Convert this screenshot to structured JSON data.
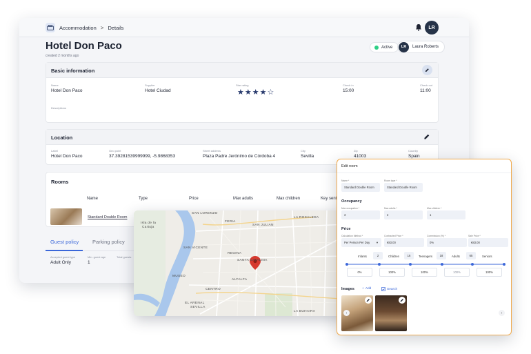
{
  "header": {
    "breadcrumb_root": "Accommodation",
    "breadcrumb_sep": ">",
    "breadcrumb_current": "Details",
    "user_initials": "LR"
  },
  "hotel": {
    "title": "Hotel Don Paco",
    "created": "created 2 months ago",
    "status": "Active",
    "user_initials": "LR",
    "user_name": "Laura Roberts"
  },
  "basic_info": {
    "title": "Basic information",
    "name_label": "Name",
    "name_value": "Hotel Don Paco",
    "supplier_label": "Supplier",
    "supplier_value": "Hotel Ciudad",
    "star_label": "Star rating",
    "star_rating": 4,
    "star_max": 5,
    "stars_text": "★★★★☆",
    "checkin_label": "Check in",
    "checkin_value": "15:00",
    "checkout_label": "Check out",
    "checkout_value": "11:00",
    "descriptions_label": "Descriptions"
  },
  "location": {
    "title": "Location",
    "label_label": "Label",
    "label_value": "Hotel Don Paco",
    "geo_label": "Geo point",
    "geo_value": "37.39281539999999, -5.9868353",
    "street_label": "Street address",
    "street_value": "Plaza Padre Jerónimo de Córdoba 4",
    "city_label": "City",
    "city_value": "Sevilla",
    "zip_label": "Zip",
    "zip_value": "41003",
    "country_label": "Country",
    "country_value": "Spain"
  },
  "rooms": {
    "title": "Rooms",
    "columns": [
      "Name",
      "Type",
      "Price",
      "Max adults",
      "Max children",
      "Key sentence"
    ],
    "row_name": "Standard Double Room"
  },
  "tabs": {
    "guest_policy": "Guest policy",
    "parking_policy": "Parking policy",
    "accepted_label": "Accepted guest type",
    "min_age_label": "Min. guest age",
    "total_label": "Total guests",
    "accepted_value": "Adult Only",
    "min_age_value": "1"
  },
  "map": {
    "labels": [
      "SAN LORENZO",
      "Isla de la",
      "Cartuja",
      "FERIA",
      "SAN JULIAN",
      "LA ROSALEDA",
      "SAN VICENTE",
      "REGINA",
      "SANTA CATALINA",
      "MUSEO",
      "ALFALFA",
      "CENTRO",
      "EL ARENAL",
      "SEVILLA",
      "LA BUHAIRA"
    ]
  },
  "edit_room": {
    "title": "Edit room",
    "name_label": "Name *",
    "name_value": "Standard Double Room",
    "room_type_label": "Room type *",
    "room_type_value": "Standard Double Room",
    "occupancy_title": "Occupancy",
    "max_occ_label": "Max occupation *",
    "max_occ_value": "3",
    "max_adults_label": "Max adults *",
    "max_adults_value": "2",
    "max_children_label": "Max children *",
    "max_children_value": "1",
    "price_title": "Price",
    "calc_label": "Calculation Method *",
    "calc_value": "Per Person Per Day",
    "contracted_label": "Contracted Price *",
    "contracted_value": "€83.00",
    "commission_label": "Commission (%) *",
    "commission_value": "0%",
    "sale_label": "Sale Price *",
    "sale_value": "€83.00",
    "ages": {
      "infants": "Infants",
      "infants_to": "2",
      "children": "Children",
      "children_to": "16",
      "teenagers": "Teenagers",
      "teenagers_to": "18",
      "adults": "Adults",
      "adults_to": "65",
      "seniors": "Seniors"
    },
    "percentages": [
      "0%",
      "100%",
      "100%",
      "100%",
      "100%"
    ],
    "images_title": "Images",
    "add_label": "Add",
    "search_label": "Search"
  },
  "colors": {
    "accent": "#3b67d9",
    "dialog_border": "#f0a94b",
    "active_dot": "#2ecf86",
    "map_pin": "#d63a2f"
  }
}
